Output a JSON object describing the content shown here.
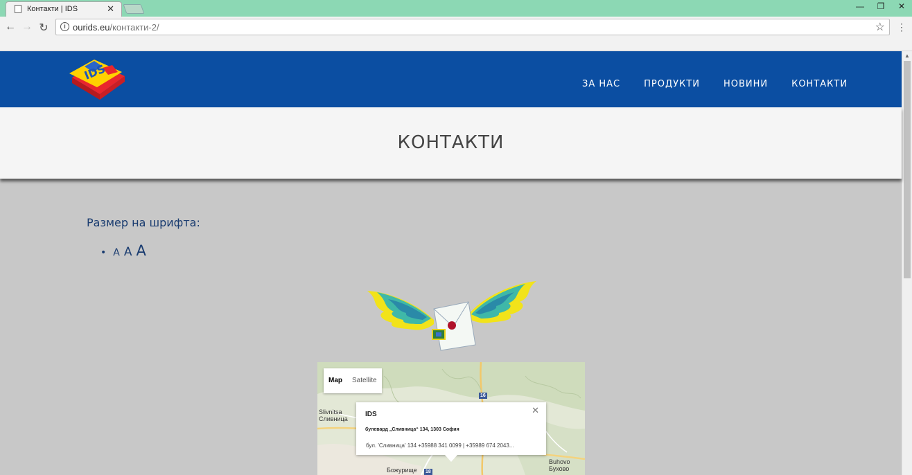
{
  "browser": {
    "tab_title": "Контакти | IDS",
    "tab_close": "✕",
    "url_domain": "ourids.eu",
    "url_path": "/контакти-2/",
    "back_icon": "←",
    "forward_icon": "→",
    "reload_icon": "↻",
    "info_icon": "i",
    "star_icon": "☆",
    "menu_icon": "⋮",
    "minimize": "—",
    "restore": "❐",
    "close": "✕"
  },
  "header": {
    "nav": [
      {
        "label": "ЗА НАС"
      },
      {
        "label": "ПРОДУКТИ"
      },
      {
        "label": "НОВИНИ"
      },
      {
        "label": "КОНТАКТИ"
      }
    ],
    "brand_color": "#0b4ea2"
  },
  "page": {
    "title": "КОНТАКТИ",
    "font_size_label": "Размер на шрифта:",
    "font_size_bullet": "•",
    "font_size_options": [
      "A",
      "A",
      "A"
    ]
  },
  "map": {
    "type_map": "Map",
    "type_satellite": "Satellite",
    "labels": {
      "slivnitsa_lat": "Slivnitsa",
      "slivnitsa_cyr": "Сливница",
      "buhovo_lat": "Buhovo",
      "buhovo_cyr": "Бухово",
      "bozhurishte": "Божурище",
      "road_16": "16",
      "road_18": "18"
    },
    "info": {
      "title": "IDS",
      "address": "булевард „Сливница“ 134, 1303 София",
      "description": "бул. 'Сливница' 134 +35988 341 0099 | +35989 674 2043...",
      "close": "✕"
    }
  }
}
